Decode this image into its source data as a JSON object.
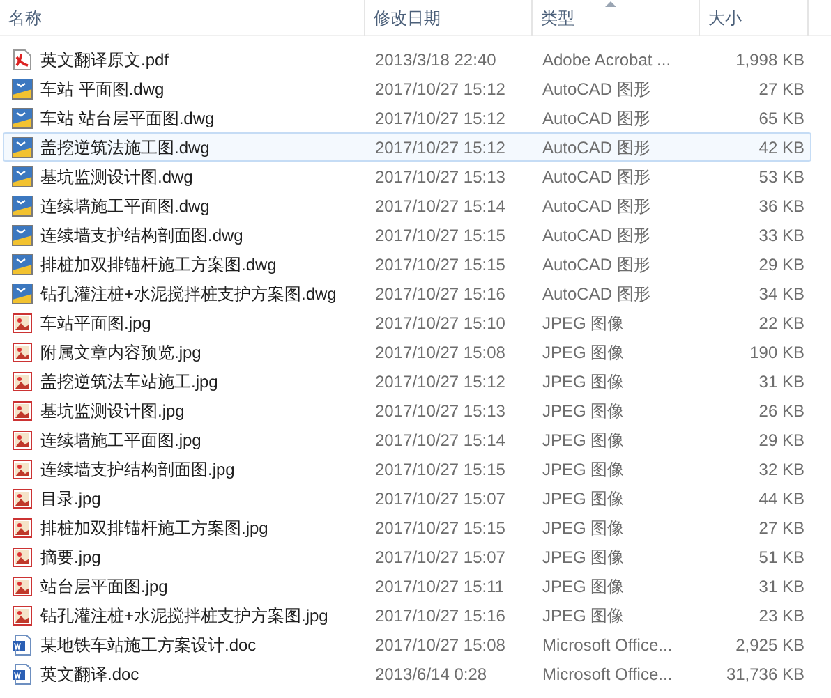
{
  "columns": [
    {
      "label": "名称",
      "sorted": false
    },
    {
      "label": "修改日期",
      "sorted": false
    },
    {
      "label": "类型",
      "sorted": true
    },
    {
      "label": "大小",
      "sorted": false
    }
  ],
  "rows": [
    {
      "kind": "pdf",
      "name": "英文翻译原文.pdf",
      "date": "2013/3/18 22:40",
      "type": "Adobe Acrobat ...",
      "size": "1,998 KB",
      "selected": false
    },
    {
      "kind": "dwg",
      "name": "车站 平面图.dwg",
      "date": "2017/10/27 15:12",
      "type": "AutoCAD 图形",
      "size": "27 KB",
      "selected": false
    },
    {
      "kind": "dwg",
      "name": "车站 站台层平面图.dwg",
      "date": "2017/10/27 15:12",
      "type": "AutoCAD 图形",
      "size": "65 KB",
      "selected": false
    },
    {
      "kind": "dwg",
      "name": "盖挖逆筑法施工图.dwg",
      "date": "2017/10/27 15:12",
      "type": "AutoCAD 图形",
      "size": "42 KB",
      "selected": true
    },
    {
      "kind": "dwg",
      "name": "基坑监测设计图.dwg",
      "date": "2017/10/27 15:13",
      "type": "AutoCAD 图形",
      "size": "53 KB",
      "selected": false
    },
    {
      "kind": "dwg",
      "name": "连续墙施工平面图.dwg",
      "date": "2017/10/27 15:14",
      "type": "AutoCAD 图形",
      "size": "36 KB",
      "selected": false
    },
    {
      "kind": "dwg",
      "name": "连续墙支护结构剖面图.dwg",
      "date": "2017/10/27 15:15",
      "type": "AutoCAD 图形",
      "size": "33 KB",
      "selected": false
    },
    {
      "kind": "dwg",
      "name": "排桩加双排锚杆施工方案图.dwg",
      "date": "2017/10/27 15:15",
      "type": "AutoCAD 图形",
      "size": "29 KB",
      "selected": false
    },
    {
      "kind": "dwg",
      "name": "钻孔灌注桩+水泥搅拌桩支护方案图.dwg",
      "date": "2017/10/27 15:16",
      "type": "AutoCAD 图形",
      "size": "34 KB",
      "selected": false
    },
    {
      "kind": "jpg",
      "name": "车站平面图.jpg",
      "date": "2017/10/27 15:10",
      "type": "JPEG 图像",
      "size": "22 KB",
      "selected": false
    },
    {
      "kind": "jpg",
      "name": "附属文章内容预览.jpg",
      "date": "2017/10/27 15:08",
      "type": "JPEG 图像",
      "size": "190 KB",
      "selected": false
    },
    {
      "kind": "jpg",
      "name": "盖挖逆筑法车站施工.jpg",
      "date": "2017/10/27 15:12",
      "type": "JPEG 图像",
      "size": "31 KB",
      "selected": false
    },
    {
      "kind": "jpg",
      "name": "基坑监测设计图.jpg",
      "date": "2017/10/27 15:13",
      "type": "JPEG 图像",
      "size": "26 KB",
      "selected": false
    },
    {
      "kind": "jpg",
      "name": "连续墙施工平面图.jpg",
      "date": "2017/10/27 15:14",
      "type": "JPEG 图像",
      "size": "29 KB",
      "selected": false
    },
    {
      "kind": "jpg",
      "name": "连续墙支护结构剖面图.jpg",
      "date": "2017/10/27 15:15",
      "type": "JPEG 图像",
      "size": "32 KB",
      "selected": false
    },
    {
      "kind": "jpg",
      "name": "目录.jpg",
      "date": "2017/10/27 15:07",
      "type": "JPEG 图像",
      "size": "44 KB",
      "selected": false
    },
    {
      "kind": "jpg",
      "name": "排桩加双排锚杆施工方案图.jpg",
      "date": "2017/10/27 15:15",
      "type": "JPEG 图像",
      "size": "27 KB",
      "selected": false
    },
    {
      "kind": "jpg",
      "name": "摘要.jpg",
      "date": "2017/10/27 15:07",
      "type": "JPEG 图像",
      "size": "51 KB",
      "selected": false
    },
    {
      "kind": "jpg",
      "name": "站台层平面图.jpg",
      "date": "2017/10/27 15:11",
      "type": "JPEG 图像",
      "size": "31 KB",
      "selected": false
    },
    {
      "kind": "jpg",
      "name": "钻孔灌注桩+水泥搅拌桩支护方案图.jpg",
      "date": "2017/10/27 15:16",
      "type": "JPEG 图像",
      "size": "23 KB",
      "selected": false
    },
    {
      "kind": "doc",
      "name": "某地铁车站施工方案设计.doc",
      "date": "2017/10/27 15:08",
      "type": "Microsoft Office...",
      "size": "2,925 KB",
      "selected": false
    },
    {
      "kind": "doc",
      "name": "英文翻译.doc",
      "date": "2013/6/14 0:28",
      "type": "Microsoft Office...",
      "size": "31,736 KB",
      "selected": false
    }
  ]
}
